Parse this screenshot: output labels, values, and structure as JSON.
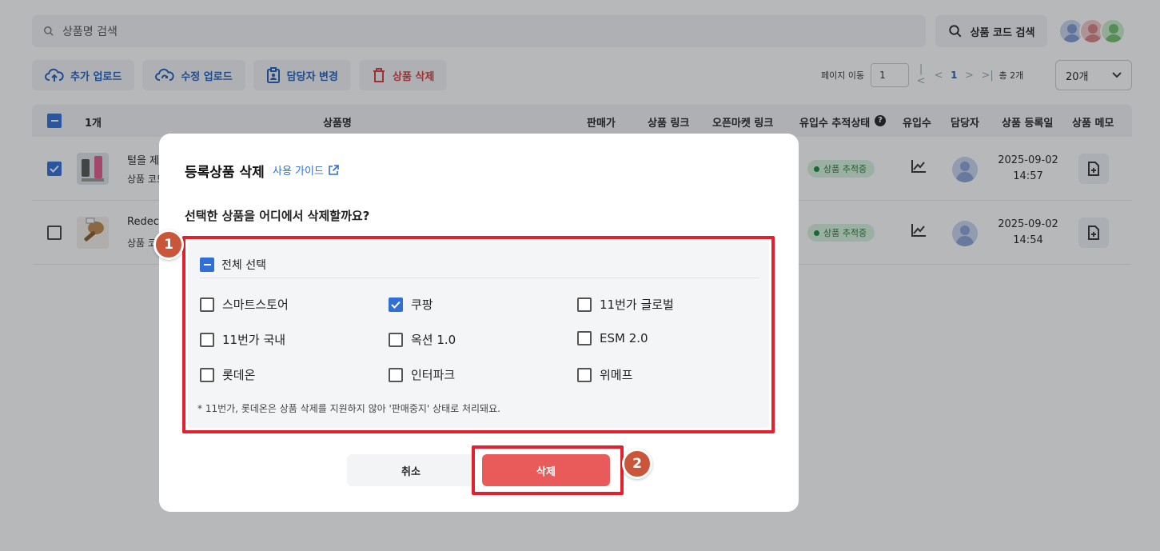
{
  "search": {
    "placeholder": "상품명 검색"
  },
  "code_search": {
    "label": "상품 코드 검색"
  },
  "toolbar": {
    "add_upload": "추가 업로드",
    "edit_upload": "수정 업로드",
    "change_manager": "담당자 변경",
    "delete_product": "상품 삭제"
  },
  "pager": {
    "go_label": "페이지 이동",
    "page_value": "1",
    "current": "1",
    "total": "총 2개",
    "per_page": "20개"
  },
  "table": {
    "selected_count": "1개",
    "headers": {
      "name": "상품명",
      "price": "판매가",
      "link": "상품 링크",
      "open_market_link": "오픈마켓 링크",
      "tracking_status": "유입수 추적상태",
      "inflow": "유입수",
      "manager": "담당자",
      "reg_date": "상품 등록일",
      "memo": "상품 메모"
    },
    "rows": [
      {
        "title": "털을 제",
        "code": "상품 코드",
        "status": "상품 추적중",
        "date": "2025-09-02",
        "time": "14:57"
      },
      {
        "title": "Redec",
        "code": "상품 코",
        "status": "상품 추적중",
        "date": "2025-09-02",
        "time": "14:54"
      }
    ]
  },
  "modal": {
    "title": "등록상품 삭제",
    "guide": "사용 가이드",
    "question": "선택한 상품을 어디에서 삭제할까요?",
    "select_all": "전체 선택",
    "markets": {
      "smartstore": "스마트스토어",
      "coupang": "쿠팡",
      "st11_global": "11번가 글로벌",
      "st11_domestic": "11번가 국내",
      "auction": "옥션 1.0",
      "esm": "ESM 2.0",
      "lotteon": "롯데온",
      "interpark": "인터파크",
      "wemakeprice": "위메프"
    },
    "note": "* 11번가, 롯데온은 상품 삭제를 지원하지 않아 '판매중지' 상태로 처리돼요.",
    "cancel": "취소",
    "delete": "삭제"
  },
  "steps": {
    "one": "1",
    "two": "2"
  },
  "colors": {
    "accent": "#2f6fd6",
    "danger": "#e95a5a",
    "highlight": "#e3202b",
    "step": "#c9563a"
  }
}
